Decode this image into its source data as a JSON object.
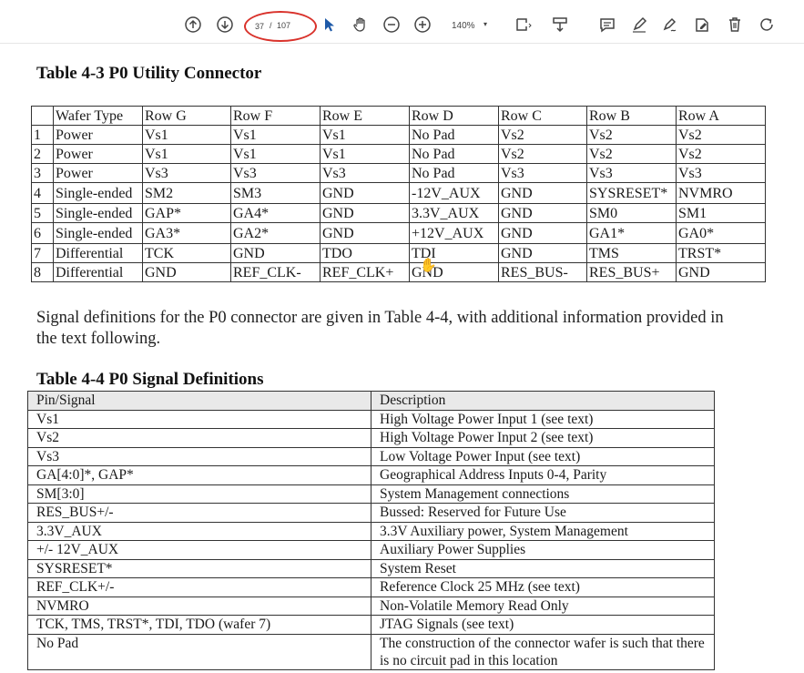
{
  "toolbar": {
    "page_current": "37",
    "page_separator": "/",
    "page_total": "107",
    "zoom": "140%"
  },
  "table43": {
    "title": "Table 4-3 P0 Utility Connector",
    "headers": [
      "",
      "Wafer Type",
      "Row G",
      "Row F",
      "Row E",
      "Row D",
      "Row C",
      "Row B",
      "Row A"
    ],
    "rows": [
      [
        "1",
        "Power",
        "Vs1",
        "Vs1",
        "Vs1",
        "No Pad",
        "Vs2",
        "Vs2",
        "Vs2"
      ],
      [
        "2",
        "Power",
        "Vs1",
        "Vs1",
        "Vs1",
        "No Pad",
        "Vs2",
        "Vs2",
        "Vs2"
      ],
      [
        "3",
        "Power",
        "Vs3",
        "Vs3",
        "Vs3",
        "No Pad",
        "Vs3",
        "Vs3",
        "Vs3"
      ],
      [
        "4",
        "Single-ended",
        "SM2",
        "SM3",
        "GND",
        "-12V_AUX",
        "GND",
        "SYSRESET*",
        "NVMRO"
      ],
      [
        "5",
        "Single-ended",
        "GAP*",
        "GA4*",
        "GND",
        "3.3V_AUX",
        "GND",
        "SM0",
        "SM1"
      ],
      [
        "6",
        "Single-ended",
        "GA3*",
        "GA2*",
        "GND",
        "+12V_AUX",
        "GND",
        "GA1*",
        "GA0*"
      ],
      [
        "7",
        "Differential",
        "TCK",
        "GND",
        "TDO",
        "TDI",
        "GND",
        "TMS",
        "TRST*"
      ],
      [
        "8",
        "Differential",
        "GND",
        "REF_CLK-",
        "REF_CLK+",
        "GND",
        "RES_BUS-",
        "RES_BUS+",
        "GND"
      ]
    ]
  },
  "paragraph": "Signal definitions for the P0 connector are given in Table 4-4, with additional information provided in the text following.",
  "table44": {
    "title": "Table 4-4 P0 Signal Definitions",
    "headers": [
      "Pin/Signal",
      "Description"
    ],
    "rows": [
      [
        "Vs1",
        "High Voltage Power Input 1 (see text)"
      ],
      [
        "Vs2",
        "High Voltage Power Input 2 (see text)"
      ],
      [
        "Vs3",
        "Low Voltage Power Input (see text)"
      ],
      [
        "GA[4:0]*, GAP*",
        "Geographical Address Inputs 0-4, Parity"
      ],
      [
        "SM[3:0]",
        "System Management connections"
      ],
      [
        "RES_BUS+/-",
        "Bussed: Reserved  for Future Use"
      ],
      [
        "3.3V_AUX",
        "3.3V Auxiliary power, System Management"
      ],
      [
        "+/- 12V_AUX",
        "Auxiliary Power Supplies"
      ],
      [
        "SYSRESET*",
        "System Reset"
      ],
      [
        "REF_CLK+/-",
        "Reference Clock 25 MHz (see text)"
      ],
      [
        "NVMRO",
        "Non-Volatile Memory Read Only"
      ],
      [
        "TCK, TMS, TRST*, TDI, TDO (wafer 7)",
        "JTAG Signals (see text)"
      ],
      [
        "No Pad",
        "The construction of the connector wafer is such that there is no circuit pad in this location"
      ]
    ]
  }
}
